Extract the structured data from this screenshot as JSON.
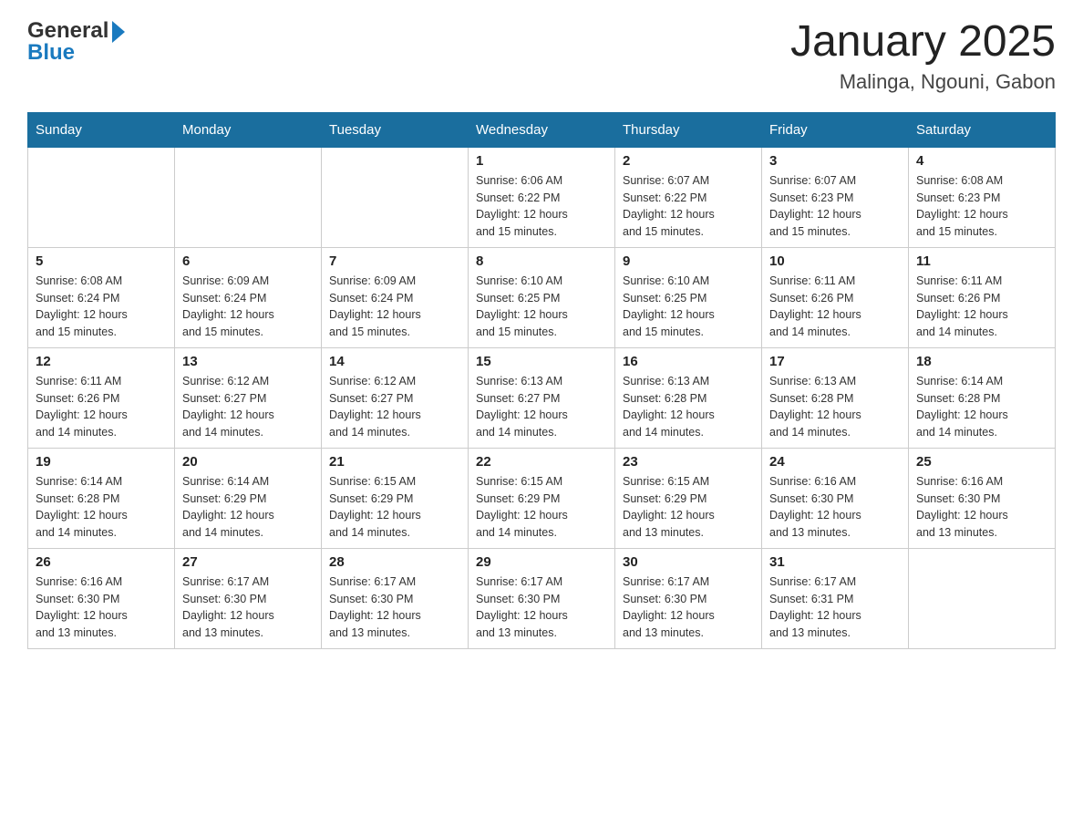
{
  "header": {
    "title": "January 2025",
    "subtitle": "Malinga, Ngouni, Gabon",
    "logo_general": "General",
    "logo_blue": "Blue"
  },
  "days_of_week": [
    "Sunday",
    "Monday",
    "Tuesday",
    "Wednesday",
    "Thursday",
    "Friday",
    "Saturday"
  ],
  "weeks": [
    [
      {
        "day": "",
        "info": ""
      },
      {
        "day": "",
        "info": ""
      },
      {
        "day": "",
        "info": ""
      },
      {
        "day": "1",
        "info": "Sunrise: 6:06 AM\nSunset: 6:22 PM\nDaylight: 12 hours\nand 15 minutes."
      },
      {
        "day": "2",
        "info": "Sunrise: 6:07 AM\nSunset: 6:22 PM\nDaylight: 12 hours\nand 15 minutes."
      },
      {
        "day": "3",
        "info": "Sunrise: 6:07 AM\nSunset: 6:23 PM\nDaylight: 12 hours\nand 15 minutes."
      },
      {
        "day": "4",
        "info": "Sunrise: 6:08 AM\nSunset: 6:23 PM\nDaylight: 12 hours\nand 15 minutes."
      }
    ],
    [
      {
        "day": "5",
        "info": "Sunrise: 6:08 AM\nSunset: 6:24 PM\nDaylight: 12 hours\nand 15 minutes."
      },
      {
        "day": "6",
        "info": "Sunrise: 6:09 AM\nSunset: 6:24 PM\nDaylight: 12 hours\nand 15 minutes."
      },
      {
        "day": "7",
        "info": "Sunrise: 6:09 AM\nSunset: 6:24 PM\nDaylight: 12 hours\nand 15 minutes."
      },
      {
        "day": "8",
        "info": "Sunrise: 6:10 AM\nSunset: 6:25 PM\nDaylight: 12 hours\nand 15 minutes."
      },
      {
        "day": "9",
        "info": "Sunrise: 6:10 AM\nSunset: 6:25 PM\nDaylight: 12 hours\nand 15 minutes."
      },
      {
        "day": "10",
        "info": "Sunrise: 6:11 AM\nSunset: 6:26 PM\nDaylight: 12 hours\nand 14 minutes."
      },
      {
        "day": "11",
        "info": "Sunrise: 6:11 AM\nSunset: 6:26 PM\nDaylight: 12 hours\nand 14 minutes."
      }
    ],
    [
      {
        "day": "12",
        "info": "Sunrise: 6:11 AM\nSunset: 6:26 PM\nDaylight: 12 hours\nand 14 minutes."
      },
      {
        "day": "13",
        "info": "Sunrise: 6:12 AM\nSunset: 6:27 PM\nDaylight: 12 hours\nand 14 minutes."
      },
      {
        "day": "14",
        "info": "Sunrise: 6:12 AM\nSunset: 6:27 PM\nDaylight: 12 hours\nand 14 minutes."
      },
      {
        "day": "15",
        "info": "Sunrise: 6:13 AM\nSunset: 6:27 PM\nDaylight: 12 hours\nand 14 minutes."
      },
      {
        "day": "16",
        "info": "Sunrise: 6:13 AM\nSunset: 6:28 PM\nDaylight: 12 hours\nand 14 minutes."
      },
      {
        "day": "17",
        "info": "Sunrise: 6:13 AM\nSunset: 6:28 PM\nDaylight: 12 hours\nand 14 minutes."
      },
      {
        "day": "18",
        "info": "Sunrise: 6:14 AM\nSunset: 6:28 PM\nDaylight: 12 hours\nand 14 minutes."
      }
    ],
    [
      {
        "day": "19",
        "info": "Sunrise: 6:14 AM\nSunset: 6:28 PM\nDaylight: 12 hours\nand 14 minutes."
      },
      {
        "day": "20",
        "info": "Sunrise: 6:14 AM\nSunset: 6:29 PM\nDaylight: 12 hours\nand 14 minutes."
      },
      {
        "day": "21",
        "info": "Sunrise: 6:15 AM\nSunset: 6:29 PM\nDaylight: 12 hours\nand 14 minutes."
      },
      {
        "day": "22",
        "info": "Sunrise: 6:15 AM\nSunset: 6:29 PM\nDaylight: 12 hours\nand 14 minutes."
      },
      {
        "day": "23",
        "info": "Sunrise: 6:15 AM\nSunset: 6:29 PM\nDaylight: 12 hours\nand 13 minutes."
      },
      {
        "day": "24",
        "info": "Sunrise: 6:16 AM\nSunset: 6:30 PM\nDaylight: 12 hours\nand 13 minutes."
      },
      {
        "day": "25",
        "info": "Sunrise: 6:16 AM\nSunset: 6:30 PM\nDaylight: 12 hours\nand 13 minutes."
      }
    ],
    [
      {
        "day": "26",
        "info": "Sunrise: 6:16 AM\nSunset: 6:30 PM\nDaylight: 12 hours\nand 13 minutes."
      },
      {
        "day": "27",
        "info": "Sunrise: 6:17 AM\nSunset: 6:30 PM\nDaylight: 12 hours\nand 13 minutes."
      },
      {
        "day": "28",
        "info": "Sunrise: 6:17 AM\nSunset: 6:30 PM\nDaylight: 12 hours\nand 13 minutes."
      },
      {
        "day": "29",
        "info": "Sunrise: 6:17 AM\nSunset: 6:30 PM\nDaylight: 12 hours\nand 13 minutes."
      },
      {
        "day": "30",
        "info": "Sunrise: 6:17 AM\nSunset: 6:30 PM\nDaylight: 12 hours\nand 13 minutes."
      },
      {
        "day": "31",
        "info": "Sunrise: 6:17 AM\nSunset: 6:31 PM\nDaylight: 12 hours\nand 13 minutes."
      },
      {
        "day": "",
        "info": ""
      }
    ]
  ]
}
